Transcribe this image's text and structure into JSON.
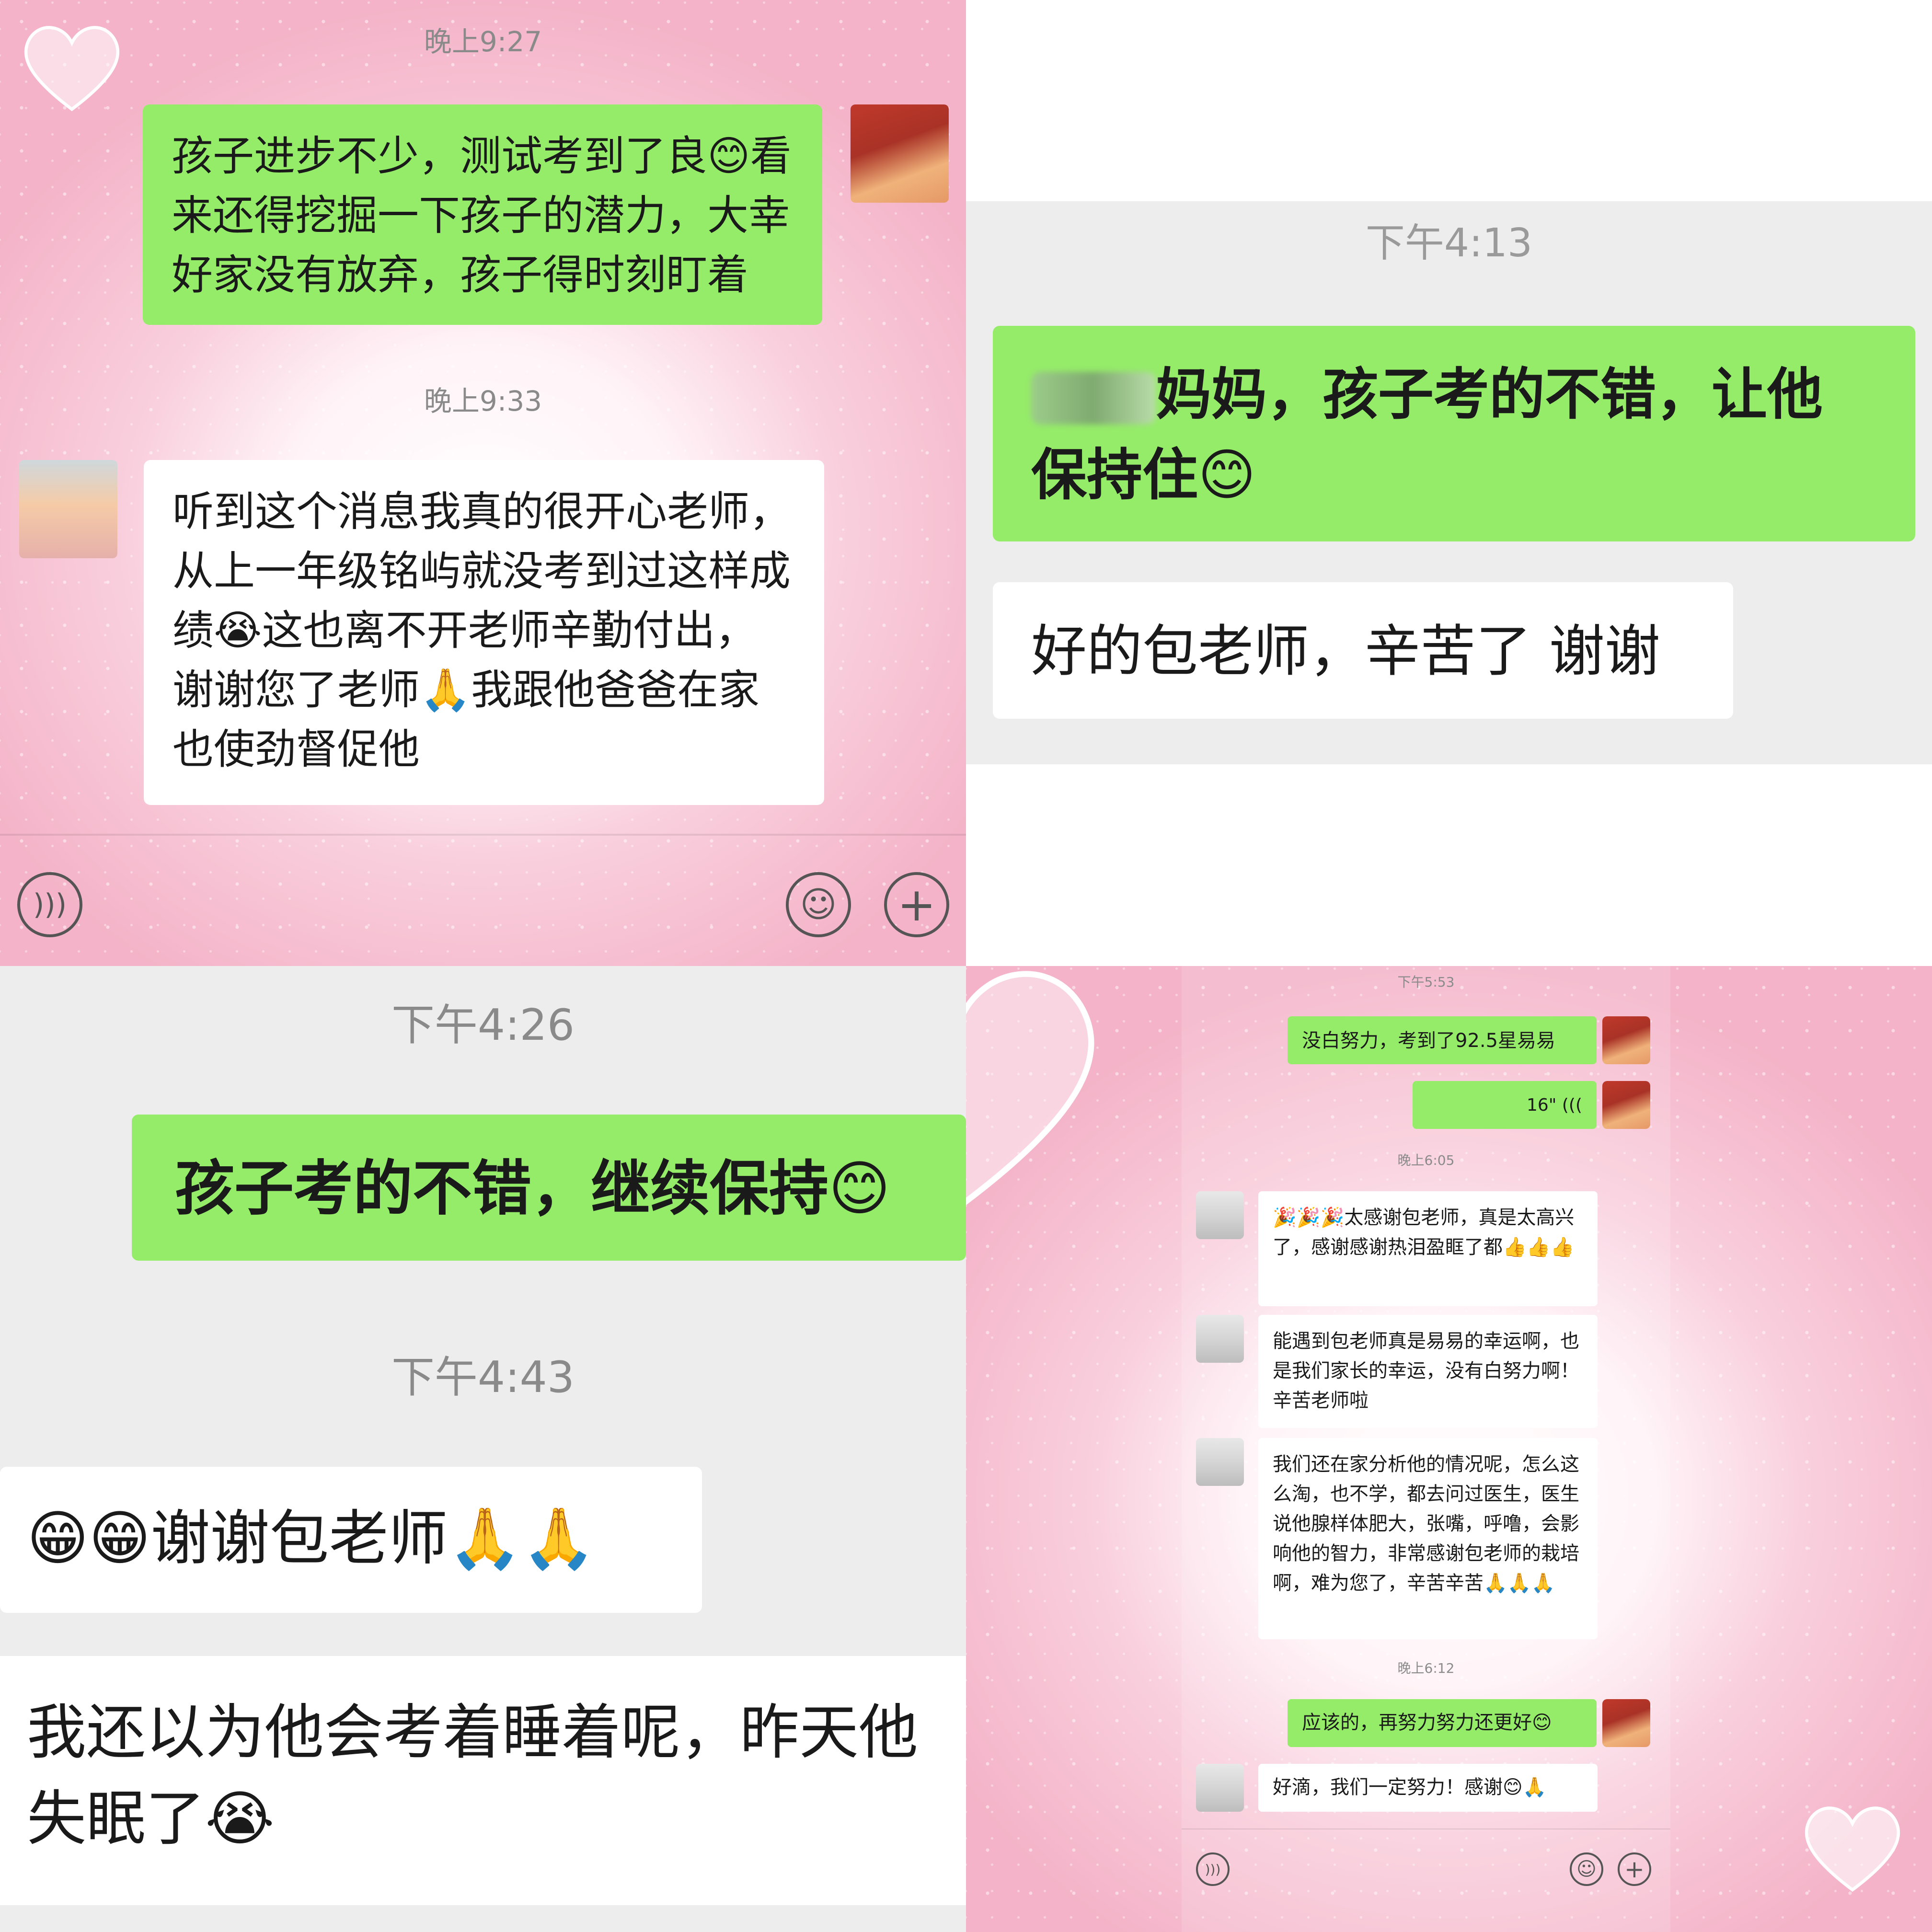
{
  "panel1": {
    "time1": "晚上9:27",
    "msg_teacher": "孩子进步不少，测试考到了良😊看来还得挖掘一下孩子的潜力，大幸好家没有放弃，孩子得时刻盯着",
    "time2": "晚上9:33",
    "msg_parent": "听到这个消息我真的很开心老师，从上一年级铭屿就没考到过这样成绩😭这也离不开老师辛勤付出，谢谢您了老师🙏我跟他爸爸在家也使劲督促他",
    "icons": [
      "voice-icon",
      "emoji-icon",
      "plus-icon"
    ]
  },
  "panel2": {
    "time": "下午4:13",
    "msg_teacher": "妈妈，孩子考的不错，让他保持住😊",
    "msg_parent": "好的包老师，辛苦了  谢谢"
  },
  "panel3": {
    "time1": "下午4:26",
    "msg_teacher": "孩子考的不错，继续保持😊",
    "time2": "下午4:43",
    "msg_parent1": "😁😁谢谢包老师🙏🙏",
    "msg_parent2": "我还以为他会考着睡着呢，昨天他失眠了😭"
  },
  "panel4": {
    "time1": "下午5:53",
    "msg_teacher1": "没白努力，考到了92.5星易易",
    "voice_duration": "16\"",
    "time2": "晚上6:05",
    "msg_parent1": "🎉🎉🎉太感谢包老师，真是太高兴了，感谢感谢热泪盈眶了都👍👍👍",
    "msg_parent2": "能遇到包老师真是易易的幸运啊，也是我们家长的幸运，没有白努力啊！辛苦老师啦",
    "msg_parent3": "我们还在家分析他的情况呢，怎么这么淘，也不学，都去问过医生，医生说他腺样体肥大，张嘴，呼噜，会影响他的智力，非常感谢包老师的栽培啊，难为您了，辛苦辛苦🙏🙏🙏",
    "time3": "晚上6:12",
    "msg_teacher2": "应该的，再努力努力还更好😊",
    "msg_parent4": "好滴，我们一定努力！感谢😊🙏"
  },
  "colors": {
    "green_bubble": "#95ec69",
    "white_bubble": "#ffffff",
    "pink_bg": "#f4b8cc",
    "gray_bg": "#ededed"
  }
}
